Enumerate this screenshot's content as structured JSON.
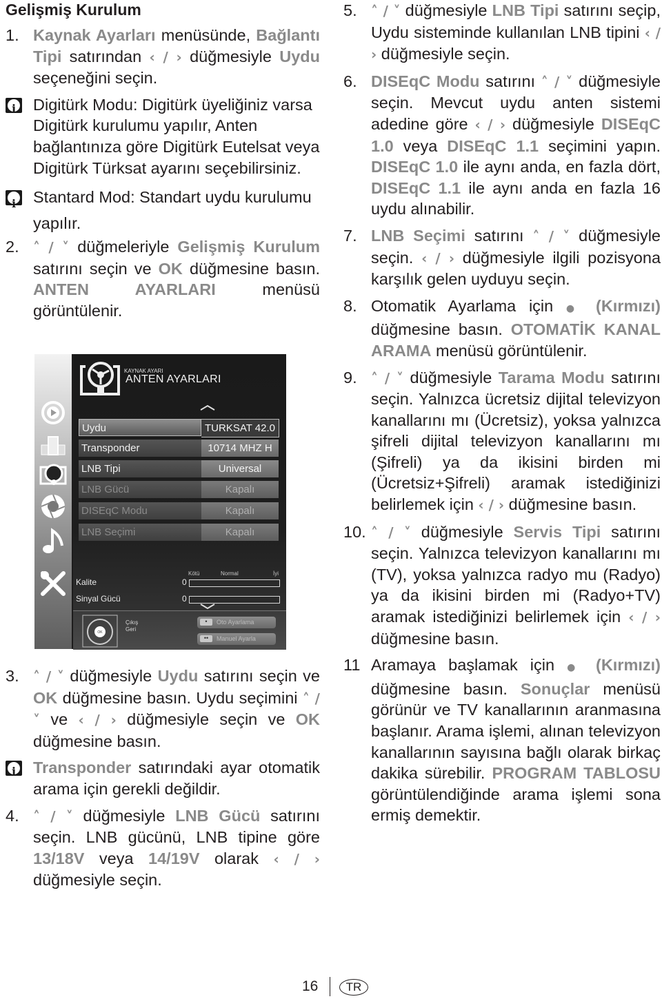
{
  "page": {
    "section_title": "Gelişmiş Kurulum",
    "page_number": "16",
    "language_badge": "TR"
  },
  "left": {
    "s1": {
      "num": "1.",
      "p1": "Kaynak Ayarları",
      "t1": " menüsünde, ",
      "p2": "Bağlantı Tipi",
      "t2": " satırından ",
      "arrows": "‹ / ›",
      "t3": " düğmesiyle ",
      "p3": "Uydu",
      "t4": " seçeneğini seçin."
    },
    "info1": "Digitürk Modu: Digitürk üyeliğiniz varsa Digitürk kurulumu yapılır, Anten bağlantınıza göre Digitürk Eutelsat veya Digitürk Türksat ayarını seçebilirsiniz.",
    "info2": "Stantard Mod: Standart uydu kurulumu yapılır.",
    "s2": {
      "num": "2.",
      "arrows": "˄ / ˅",
      "t1": " düğmeleriyle ",
      "p1": "Gelişmiş Kurulum",
      "t2": " satırını seçin ve ",
      "p2": "OK",
      "t3": " düğmesine basın. ",
      "p3": "ANTEN AYARLARI",
      "t4": " menüsü görüntülenir."
    },
    "s3": {
      "num": "3.",
      "arrows1": "˄ / ˅",
      "t1": " düğmesiyle ",
      "p1": "Uydu",
      "t2": " satırını seçin ve ",
      "p2": "OK",
      "t3": " düğmesine basın. Uydu seçimini ",
      "arrows2": "˄ / ˅",
      "t4": " ve ",
      "arrows3": "‹ / ›",
      "t5": " düğmesiyle seçin ve ",
      "p3": "OK",
      "t6": " düğmesine basın."
    },
    "info3": {
      "p1": "Transponder",
      "t1": " satırındaki ayar otomatik arama için gerekli değildir."
    },
    "s4": {
      "num": "4.",
      "arrows1": "˄ / ˅",
      "t1": " düğmesiyle ",
      "p1": "LNB Gücü",
      "t2": " satırını seçin. LNB gücünü, LNB tipine göre ",
      "p2": "13/18V",
      "t3": " veya ",
      "p3": "14/19V",
      "t4": " olarak ",
      "arrows2": "‹ / ›",
      "t5": " düğmesiyle seçin."
    }
  },
  "right": {
    "s5": {
      "num": "5.",
      "arrows1": "˄ / ˅",
      "t1": " düğmesiyle ",
      "p1": "LNB Tipi",
      "t2": " satırını seçip, Uydu sisteminde kullanılan LNB tipini ",
      "arrows2": "‹ / ›",
      "t3": " düğmesiyle seçin."
    },
    "s6": {
      "num": "6.",
      "p1": "DISEqC Modu",
      "t1": " satırını ",
      "arrows1": "˄ / ˅",
      "t2": " düğmesiyle seçin. Mevcut uydu anten sistemi adedine göre ",
      "arrows2": "‹ / ›",
      "t3": " düğmesiyle ",
      "p2": "DISEqC 1.0",
      "t4": " veya ",
      "p3": "DISEqC 1.1",
      "t5": " seçimini yapın. ",
      "p4": "DISEqC 1.0",
      "t6": " ile aynı anda, en fazla dört, ",
      "p5": "DISEqC 1.1",
      "t7": " ile aynı anda en fazla 16 uydu alınabilir."
    },
    "s7": {
      "num": "7.",
      "p1": "LNB Seçimi",
      "t1": " satırını ",
      "arrows1": "˄ / ˅",
      "t2": " düğmesiyle seçin. ",
      "arrows2": "‹ / ›",
      "t3": " düğmesiyle ilgili pozisyona karşılık gelen uyduyu seçin."
    },
    "s8": {
      "num": "8.",
      "t1": "Otomatik Ayarlama için ",
      "dot": "●",
      "p1": " (Kırmızı)",
      "t2": " düğmesine basın. ",
      "p2": "OTOMATİK KANAL ARAMA",
      "t3": " menüsü görüntülenir."
    },
    "s9": {
      "num": "9.",
      "arrows1": "˄ / ˅",
      "t1": " düğmesiyle ",
      "p1": "Tarama Modu",
      "t2": " satırını seçin. Yalnızca ücretsiz dijital televizyon kanallarını mı (Ücretsiz), yoksa yalnızca şifreli dijital televizyon kanallarını mı (Şifreli) ya da ikisini birden mi (Ücretsiz+Şifreli) aramak istediğinizi belirlemek için ",
      "arrows2": "‹ / ›",
      "t3": " düğmesine basın."
    },
    "s10": {
      "num": "10.",
      "arrows1": "˄ / ˅",
      "t1": " düğmesiyle ",
      "p1": "Servis Tipi",
      "t2": " satırını seçin. Yalnızca televizyon kanallarını mı (TV), yoksa yalnızca radyo mu (Radyo) ya da ikisini birden mi (Radyo+TV) aramak istediğinizi belirlemek için ",
      "arrows2": "‹ / ›",
      "t3": " düğmesine basın."
    },
    "s11": {
      "num": "11",
      "t1": "Aramaya başlamak için ",
      "dot": "●",
      "p1": " (Kırmızı)",
      "t2": " düğmesine basın. ",
      "p2": "Sonuçlar",
      "t3": " menüsü görünür ve TV kanallarının aranmasına başlanır. Arama işlemi, alınan televizyon kanallarının sayısına bağlı olarak birkaç dakika sürebilir. ",
      "p3": "PROGRAM TABLOSU",
      "t4": " görüntülendiğinde arama işlemi sona ermiş demektir."
    }
  },
  "tv_menu": {
    "subtitle": "KAYNAK AYARI",
    "title": "ANTEN AYARLARI",
    "sidebar_icons": [
      "source-play-icon",
      "devices-icon",
      "satellite-dish-icon",
      "aperture-icon",
      "music-note-icon",
      "tools-icon"
    ],
    "rows": [
      {
        "label": "Uydu",
        "value": "TURKSAT 42.0",
        "state": "selected"
      },
      {
        "label": "Transponder",
        "value": "10714 MHZ H",
        "state": "normal"
      },
      {
        "label": "LNB Tipi",
        "value": "Universal",
        "state": "normal"
      },
      {
        "label": "LNB Gücü",
        "value": "Kapalı",
        "state": "disabled"
      },
      {
        "label": "DISEqC Modu",
        "value": "Kapalı",
        "state": "disabled"
      },
      {
        "label": "LNB Seçimi",
        "value": "Kapalı",
        "state": "disabled"
      }
    ],
    "signal": {
      "scale": [
        "Kötü",
        "Normal",
        "İyi"
      ],
      "quality_label": "Kalite",
      "quality_value": "0",
      "quality_fraction": 0,
      "strength_label": "Sinyal Gücü",
      "strength_value": "0",
      "strength_fraction": 0
    },
    "footer": {
      "exit_label": "Çıkış",
      "back_label": "Geri",
      "ok_label": "OK",
      "auto_button": "Oto Ayarlama",
      "auto_button_key": "•",
      "manual_button": "Manuel Ayarla",
      "manual_button_key": "••"
    }
  },
  "colors": {
    "highlight_text": "#8a8a8a",
    "body_text": "#231f20",
    "tv_background": "#1d1c1c"
  }
}
